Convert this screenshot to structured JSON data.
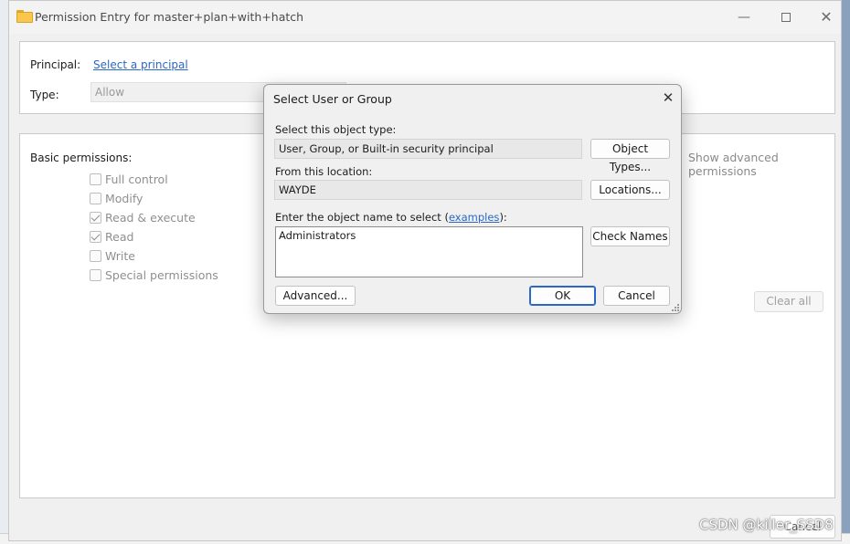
{
  "window": {
    "title": "Permission Entry for master+plan+with+hatch",
    "minimize": "—",
    "close": "✕"
  },
  "principal": {
    "label": "Principal:",
    "link": "Select a principal"
  },
  "type": {
    "label": "Type:",
    "value": "Allow"
  },
  "permissions": {
    "heading": "Basic permissions:",
    "show_advanced": "Show advanced permissions",
    "clear_all": "Clear all",
    "items": [
      {
        "label": "Full control",
        "checked": false
      },
      {
        "label": "Modify",
        "checked": false
      },
      {
        "label": "Read & execute",
        "checked": true
      },
      {
        "label": "Read",
        "checked": true
      },
      {
        "label": "Write",
        "checked": false
      },
      {
        "label": "Special permissions",
        "checked": false
      }
    ]
  },
  "footer": {
    "cancel": "Cancel",
    "watermark": "CSDN @killer_SSD8"
  },
  "dialog": {
    "title": "Select User or Group",
    "close": "✕",
    "object_type_label": "Select this object type:",
    "object_type_value": "User, Group, or Built-in security principal",
    "object_types_button": "Object Types...",
    "location_label": "From this location:",
    "location_value": "WAYDE",
    "locations_button": "Locations...",
    "enter_label_pre": "Enter the object name to select (",
    "enter_label_link": "examples",
    "enter_label_post": "):",
    "object_name": "Administrators",
    "check_names_button": "Check Names",
    "advanced_button": "Advanced...",
    "ok_button": "OK",
    "cancel_button": "Cancel"
  }
}
